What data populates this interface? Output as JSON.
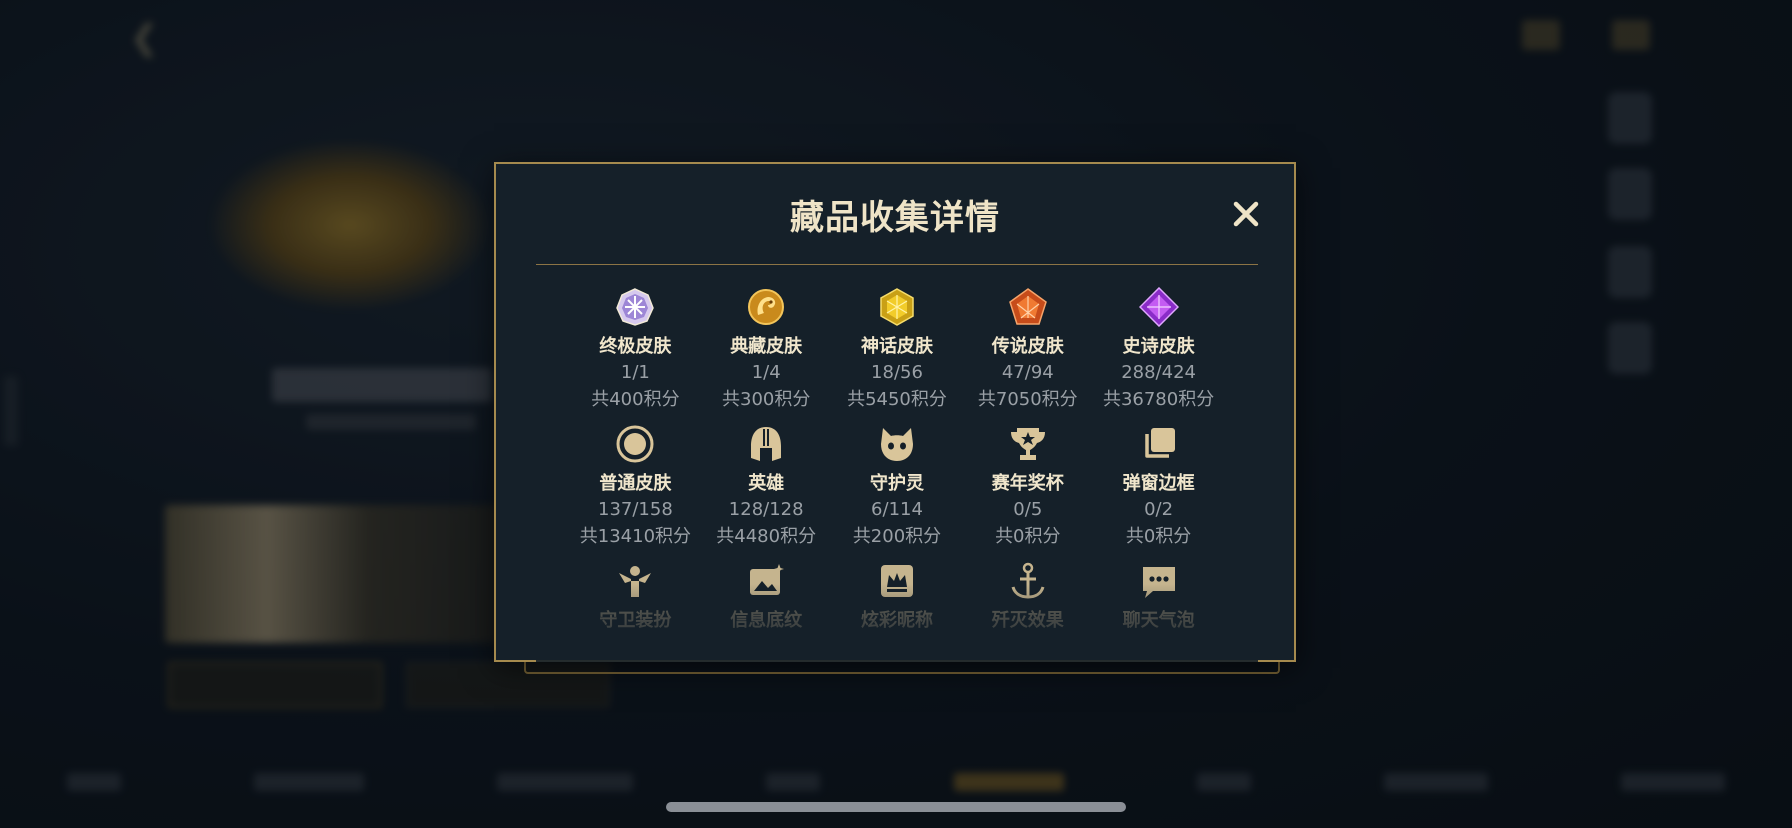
{
  "modal": {
    "title": "藏品收集详情",
    "close_label": "✕",
    "items": [
      {
        "label": "终极皮肤",
        "count": "1/1",
        "points": "共400积分",
        "icon": "ultimate-skin-icon"
      },
      {
        "label": "典藏皮肤",
        "count": "1/4",
        "points": "共300积分",
        "icon": "collection-skin-icon"
      },
      {
        "label": "神话皮肤",
        "count": "18/56",
        "points": "共5450积分",
        "icon": "mythic-skin-icon"
      },
      {
        "label": "传说皮肤",
        "count": "47/94",
        "points": "共7050积分",
        "icon": "legendary-skin-icon"
      },
      {
        "label": "史诗皮肤",
        "count": "288/424",
        "points": "共36780积分",
        "icon": "epic-skin-icon"
      },
      {
        "label": "普通皮肤",
        "count": "137/158",
        "points": "共13410积分",
        "icon": "normal-skin-icon"
      },
      {
        "label": "英雄",
        "count": "128/128",
        "points": "共4480积分",
        "icon": "hero-helmet-icon"
      },
      {
        "label": "守护灵",
        "count": "6/114",
        "points": "共200积分",
        "icon": "guardian-spirit-icon"
      },
      {
        "label": "赛年奖杯",
        "count": "0/5",
        "points": "共0积分",
        "icon": "season-trophy-icon"
      },
      {
        "label": "弹窗边框",
        "count": "0/2",
        "points": "共0积分",
        "icon": "popup-frame-icon"
      },
      {
        "label": "守卫装扮",
        "icon": "guard-outfit-icon"
      },
      {
        "label": "信息底纹",
        "icon": "info-background-icon"
      },
      {
        "label": "炫彩昵称",
        "icon": "colorful-nickname-icon"
      },
      {
        "label": "歼灭效果",
        "icon": "annihilation-effect-icon"
      },
      {
        "label": "聊天气泡",
        "icon": "chat-bubble-icon"
      }
    ]
  },
  "colors": {
    "modal_bg": "#152029",
    "modal_border": "#a58a4e",
    "title_text": "#efe4c7",
    "muted_text": "#9aa0a6",
    "icon_gold": "#d9c59a"
  }
}
